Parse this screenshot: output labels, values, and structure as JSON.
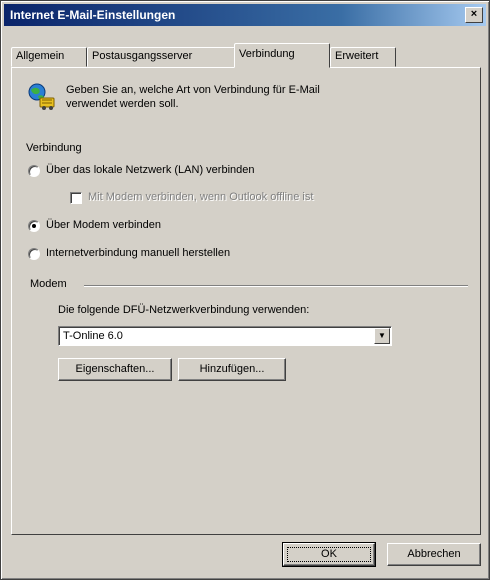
{
  "window": {
    "title": "Internet E-Mail-Einstellungen",
    "close_symbol": "×"
  },
  "tabs": [
    {
      "label": "Allgemein",
      "active": false
    },
    {
      "label": "Postausgangsserver",
      "active": false
    },
    {
      "label": "Verbindung",
      "active": true
    },
    {
      "label": "Erweitert",
      "active": false
    }
  ],
  "info": {
    "text_line1": "Geben Sie an, welche Art von Verbindung für E-Mail",
    "text_line2": "verwendet werden soll.",
    "icon": "network-globe-icon"
  },
  "connection": {
    "heading": "Verbindung",
    "lan_label": "Über das lokale Netzwerk (LAN) verbinden",
    "modem_offline_label": "Mit Modem verbinden, wenn Outlook offline ist",
    "modem_label": "Über Modem verbinden",
    "manual_label": "Internetverbindung manuell herstellen",
    "selected": "modem"
  },
  "modem": {
    "heading": "Modem",
    "use_label": "Die folgende DFÜ-Netzwerkverbindung verwenden:",
    "selected_connection": "T-Online 6.0",
    "properties_button": "Eigenschaften...",
    "add_button": "Hinzufügen..."
  },
  "footer": {
    "ok_button": "OK",
    "cancel_button": "Abbrechen"
  }
}
